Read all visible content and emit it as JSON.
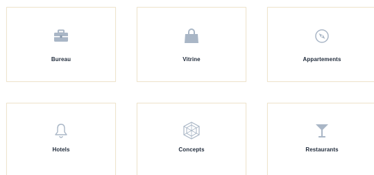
{
  "colors": {
    "card_border": "#efe4cc",
    "icon": "#a9b6c6",
    "label": "#1f2a3a",
    "background": "#ffffff"
  },
  "categories": [
    {
      "label": "Bureau",
      "icon": "briefcase-icon"
    },
    {
      "label": "Vitrine",
      "icon": "shopping-bag-icon"
    },
    {
      "label": "Appartements",
      "icon": "compass-icon"
    },
    {
      "label": "Hotels",
      "icon": "bell-icon"
    },
    {
      "label": "Concepts",
      "icon": "hexagon-icon"
    },
    {
      "label": "Restaurants",
      "icon": "cocktail-glass-icon"
    }
  ]
}
